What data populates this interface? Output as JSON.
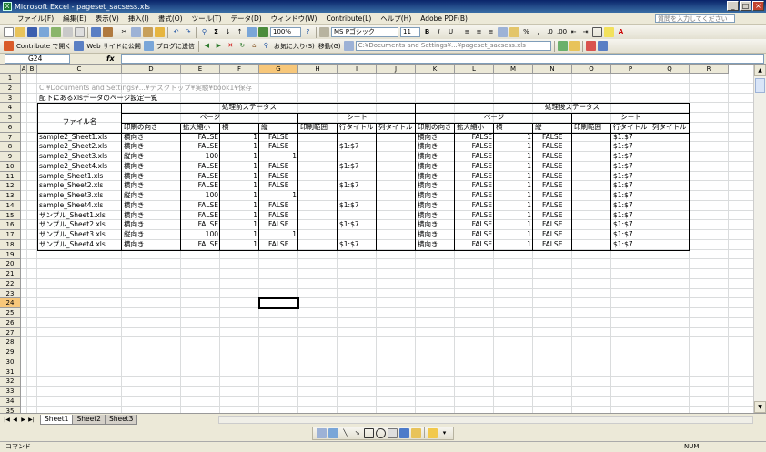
{
  "window": {
    "title": "Microsoft Excel - pageset_sacsess.xls"
  },
  "menu": {
    "items": [
      "ファイル(F)",
      "編集(E)",
      "表示(V)",
      "挿入(I)",
      "書式(O)",
      "ツール(T)",
      "データ(D)",
      "ウィンドウ(W)",
      "Contribute(L)",
      "ヘルプ(H)",
      "Adobe PDF(B)"
    ],
    "help_placeholder": "質問を入力してください"
  },
  "toolbar1": {
    "zoom": "100%",
    "font_name": "MS Pゴシック",
    "font_size": "11"
  },
  "toolbar2": {
    "contribute_open": "Contribute で開く",
    "publish_web": "Web サイドに公開",
    "blog_post": "ブログに送信",
    "favorites": "お気に入り(S)",
    "move": "移動(G)",
    "address": "C:¥Documents and Settings¥...¥pageset_sacsess.xls"
  },
  "formula": {
    "name_box": "G24",
    "fx": "fx",
    "content": ""
  },
  "columns": [
    "A",
    "B",
    "C",
    "D",
    "E",
    "F",
    "G",
    "H",
    "I",
    "J",
    "K",
    "L",
    "M",
    "N",
    "O",
    "P",
    "Q",
    "R"
  ],
  "rows": [
    "1",
    "2",
    "3",
    "4",
    "5",
    "6",
    "7",
    "8",
    "9",
    "10",
    "11",
    "12",
    "13",
    "14",
    "15",
    "16",
    "17",
    "18",
    "19",
    "20",
    "21",
    "22",
    "23",
    "24",
    "25",
    "26",
    "27",
    "28",
    "29",
    "30",
    "31",
    "32",
    "33",
    "34",
    "35"
  ],
  "sheet": {
    "a2": "C:¥Documents and Settings¥...¥デスクトップ¥実験¥book1¥保存",
    "a3": "配下にあるxlsデータのページ設定一覧",
    "header_before": "処理前ステータス",
    "header_after": "処理後ステータス",
    "header_page": "ページ",
    "header_sheet": "シート",
    "header_file": "ファイル名",
    "sub_headers": [
      "印刷の向き",
      "拡大縮小",
      "横",
      "縦",
      "印刷範囲",
      "行タイトル",
      "列タイトル"
    ]
  },
  "records": [
    {
      "file": "sample2_Sheet1.xls",
      "orient": "横向き",
      "scale": "FALSE",
      "w": "1",
      "h": "FALSE",
      "row_title": "",
      "orient2": "横向き",
      "scale2": "FALSE",
      "w2": "1",
      "h2": "FALSE",
      "row_title2": "$1:$7"
    },
    {
      "file": "sample2_Sheet2.xls",
      "orient": "横向き",
      "scale": "FALSE",
      "w": "1",
      "h": "FALSE",
      "row_title": "$1:$7",
      "orient2": "横向き",
      "scale2": "FALSE",
      "w2": "1",
      "h2": "FALSE",
      "row_title2": "$1:$7"
    },
    {
      "file": "sample2_Sheet3.xls",
      "orient": "縦向き",
      "scale": "100",
      "w": "1",
      "h": "1",
      "row_title": "",
      "orient2": "横向き",
      "scale2": "FALSE",
      "w2": "1",
      "h2": "FALSE",
      "row_title2": "$1:$7"
    },
    {
      "file": "sample2_Sheet4.xls",
      "orient": "横向き",
      "scale": "FALSE",
      "w": "1",
      "h": "FALSE",
      "row_title": "$1:$7",
      "orient2": "横向き",
      "scale2": "FALSE",
      "w2": "1",
      "h2": "FALSE",
      "row_title2": "$1:$7"
    },
    {
      "file": "sample_Sheet1.xls",
      "orient": "横向き",
      "scale": "FALSE",
      "w": "1",
      "h": "FALSE",
      "row_title": "",
      "orient2": "横向き",
      "scale2": "FALSE",
      "w2": "1",
      "h2": "FALSE",
      "row_title2": "$1:$7"
    },
    {
      "file": "sample_Sheet2.xls",
      "orient": "横向き",
      "scale": "FALSE",
      "w": "1",
      "h": "FALSE",
      "row_title": "$1:$7",
      "orient2": "横向き",
      "scale2": "FALSE",
      "w2": "1",
      "h2": "FALSE",
      "row_title2": "$1:$7"
    },
    {
      "file": "sample_Sheet3.xls",
      "orient": "縦向き",
      "scale": "100",
      "w": "1",
      "h": "1",
      "row_title": "",
      "orient2": "横向き",
      "scale2": "FALSE",
      "w2": "1",
      "h2": "FALSE",
      "row_title2": "$1:$7"
    },
    {
      "file": "sample_Sheet4.xls",
      "orient": "横向き",
      "scale": "FALSE",
      "w": "1",
      "h": "FALSE",
      "row_title": "$1:$7",
      "orient2": "横向き",
      "scale2": "FALSE",
      "w2": "1",
      "h2": "FALSE",
      "row_title2": "$1:$7"
    },
    {
      "file": "サンプル_Sheet1.xls",
      "orient": "横向き",
      "scale": "FALSE",
      "w": "1",
      "h": "FALSE",
      "row_title": "",
      "orient2": "横向き",
      "scale2": "FALSE",
      "w2": "1",
      "h2": "FALSE",
      "row_title2": "$1:$7"
    },
    {
      "file": "サンプル_Sheet2.xls",
      "orient": "横向き",
      "scale": "FALSE",
      "w": "1",
      "h": "FALSE",
      "row_title": "$1:$7",
      "orient2": "横向き",
      "scale2": "FALSE",
      "w2": "1",
      "h2": "FALSE",
      "row_title2": "$1:$7"
    },
    {
      "file": "サンプル_Sheet3.xls",
      "orient": "縦向き",
      "scale": "100",
      "w": "1",
      "h": "1",
      "row_title": "",
      "orient2": "横向き",
      "scale2": "FALSE",
      "w2": "1",
      "h2": "FALSE",
      "row_title2": "$1:$7"
    },
    {
      "file": "サンプル_Sheet4.xls",
      "orient": "横向き",
      "scale": "FALSE",
      "w": "1",
      "h": "FALSE",
      "row_title": "$1:$7",
      "orient2": "横向き",
      "scale2": "FALSE",
      "w2": "1",
      "h2": "FALSE",
      "row_title2": "$1:$7"
    }
  ],
  "tabs": [
    "Sheet1",
    "Sheet2",
    "Sheet3"
  ],
  "status": {
    "left": "コマンド",
    "num": "NUM"
  },
  "colors": {
    "selected_header": "#f7c77a",
    "title_bar": "#0a246a"
  }
}
